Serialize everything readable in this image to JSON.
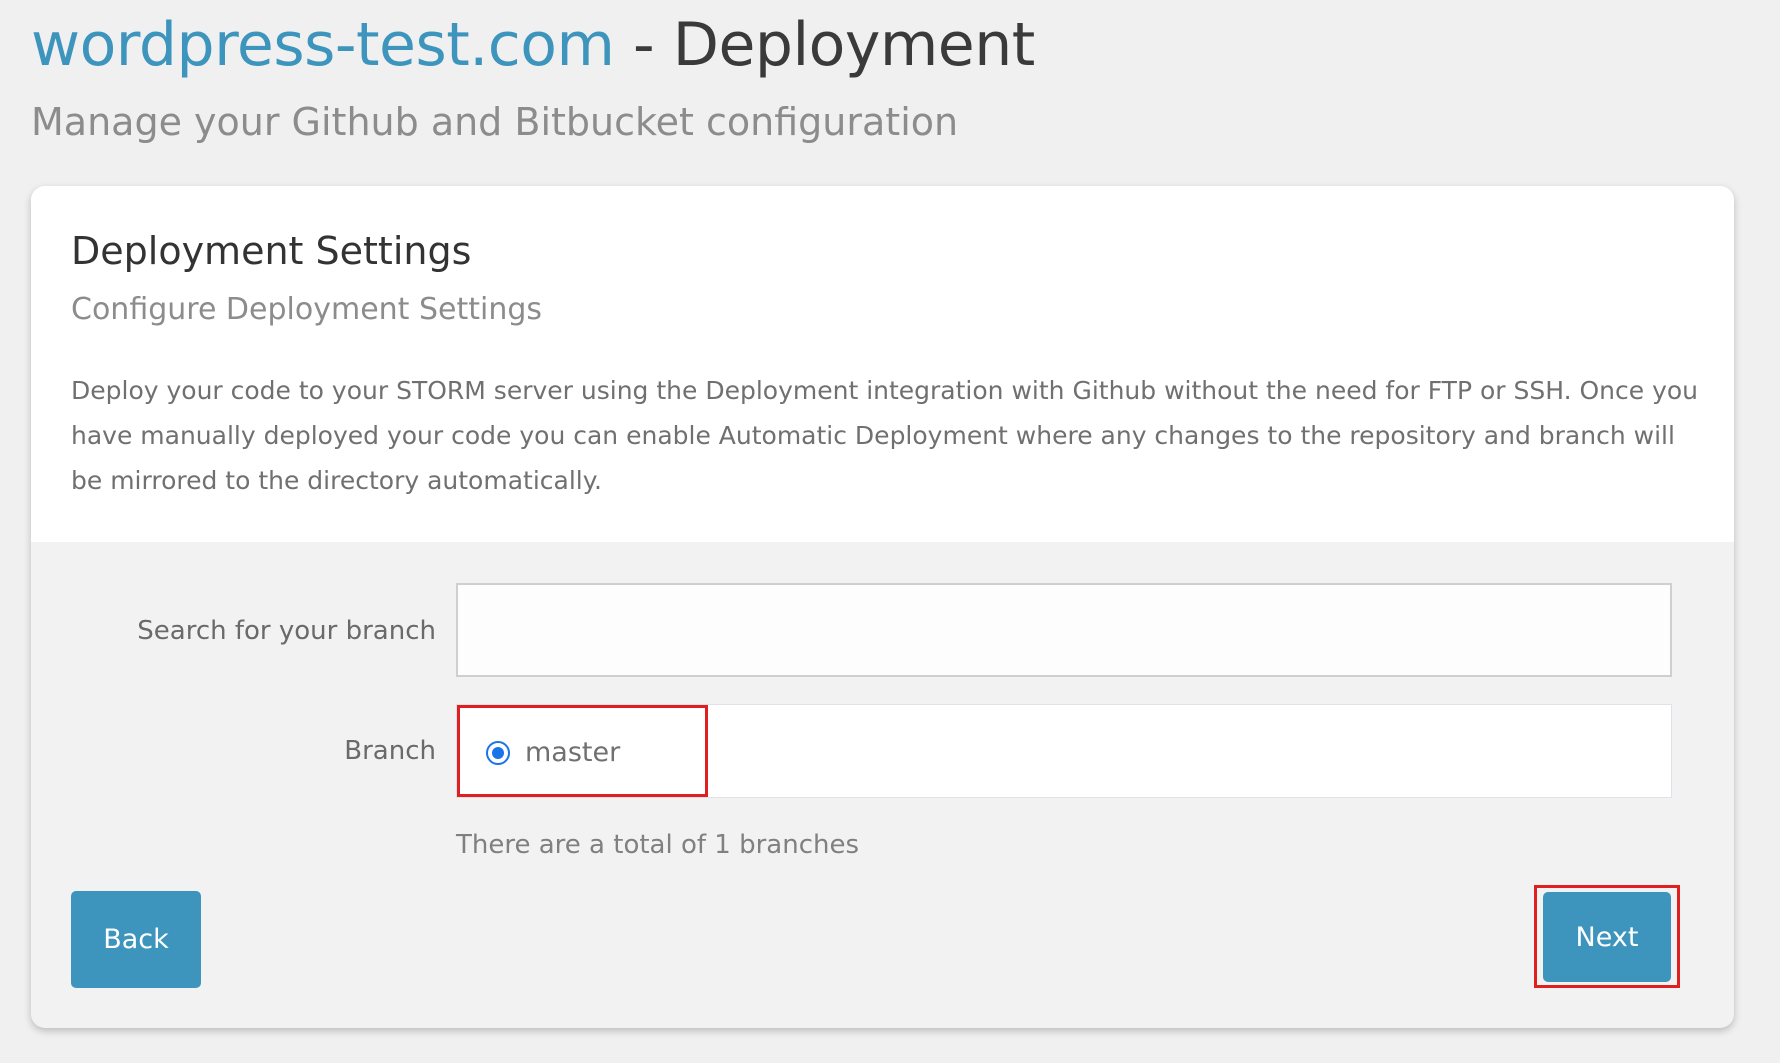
{
  "header": {
    "site_name": "wordpress-test.com",
    "title_separator": " - ",
    "title": "Deployment",
    "subtitle": "Manage your Github and Bitbucket configuration"
  },
  "card": {
    "title": "Deployment Settings",
    "subtitle": "Configure Deployment Settings",
    "description": "Deploy your code to your STORM server using the Deployment integration with Github without the need for FTP or SSH. Once you have manually deployed your code you can enable Automatic Deployment where any changes to the repository and branch will be mirrored to the directory automatically."
  },
  "form": {
    "search_label": "Search for your branch",
    "search_value": "",
    "search_placeholder": "",
    "branch_label": "Branch",
    "branches": [
      {
        "name": "master",
        "selected": true
      }
    ],
    "branch_count_text": "There are a total of 1 branches"
  },
  "actions": {
    "back_label": "Back",
    "next_label": "Next"
  },
  "colors": {
    "accent": "#3d95bd",
    "highlight": "#e02020",
    "radio": "#1a73e8"
  }
}
